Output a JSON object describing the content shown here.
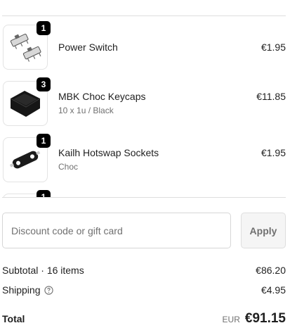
{
  "items": [
    {
      "name": "Power Switch",
      "variant": "",
      "price": "€1.95",
      "quantity": "1",
      "image_icon": "power-switch-icon"
    },
    {
      "name": "MBK Choc Keycaps",
      "variant": "10 x 1u / Black",
      "price": "€11.85",
      "quantity": "3",
      "image_icon": "keycap-icon"
    },
    {
      "name": "Kailh Hotswap Sockets",
      "variant": "Choc",
      "price": "€1.95",
      "quantity": "1",
      "image_icon": "hotswap-socket-icon"
    },
    {
      "name": "",
      "variant": "",
      "price": "",
      "quantity": "1",
      "image_icon": ""
    }
  ],
  "discount": {
    "placeholder": "Discount code or gift card",
    "apply_label": "Apply"
  },
  "summary": {
    "subtotal_label": "Subtotal · 16 items",
    "subtotal_value": "€86.20",
    "shipping_label": "Shipping",
    "shipping_value": "€4.95",
    "total_label": "Total",
    "currency": "EUR",
    "total_value": "€91.15"
  }
}
